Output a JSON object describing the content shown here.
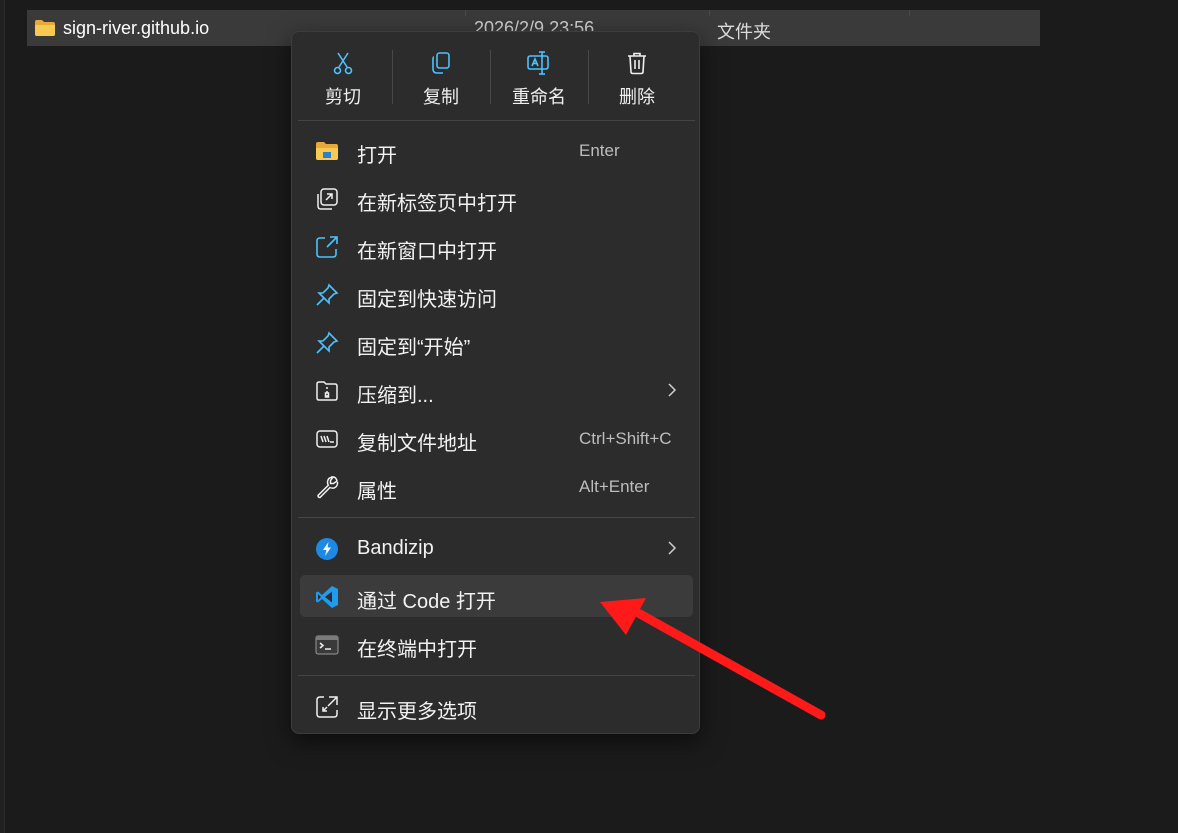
{
  "file_list": {
    "row": {
      "name": "sign-river.github.io",
      "date": "2026/2/9 23:56",
      "type": "文件夹",
      "icon": "folder-icon"
    }
  },
  "context_menu": {
    "toolbar": [
      {
        "label": "剪切",
        "icon": "cut-icon"
      },
      {
        "label": "复制",
        "icon": "copy-icon"
      },
      {
        "label": "重命名",
        "icon": "rename-icon"
      },
      {
        "label": "删除",
        "icon": "delete-icon"
      }
    ],
    "items": [
      {
        "label": "打开",
        "shortcut": "Enter",
        "icon": "folder-open-icon"
      },
      {
        "label": "在新标签页中打开",
        "icon": "new-tab-icon"
      },
      {
        "label": "在新窗口中打开",
        "icon": "new-window-icon"
      },
      {
        "label": "固定到快速访问",
        "icon": "pin-icon"
      },
      {
        "label": "固定到“开始”",
        "icon": "pin-icon"
      },
      {
        "label": "压缩到...",
        "icon": "zip-folder-icon",
        "has_submenu": true
      },
      {
        "label": "复制文件地址",
        "shortcut": "Ctrl+Shift+C",
        "icon": "copy-path-icon"
      },
      {
        "label": "属性",
        "shortcut": "Alt+Enter",
        "icon": "wrench-icon"
      }
    ],
    "extra_items": [
      {
        "label": "Bandizip",
        "icon": "bandizip-icon",
        "has_submenu": true
      },
      {
        "label": "通过 Code 打开",
        "icon": "vscode-icon",
        "highlighted": true
      },
      {
        "label": "在终端中打开",
        "icon": "terminal-icon"
      }
    ],
    "footer_item": {
      "label": "显示更多选项",
      "icon": "more-options-icon"
    }
  },
  "colors": {
    "accent": "#4cc2ff",
    "annotation_arrow": "#ff1a1a",
    "menu_bg": "#2c2c2c",
    "selected_row_bg": "#3a3a3a"
  }
}
